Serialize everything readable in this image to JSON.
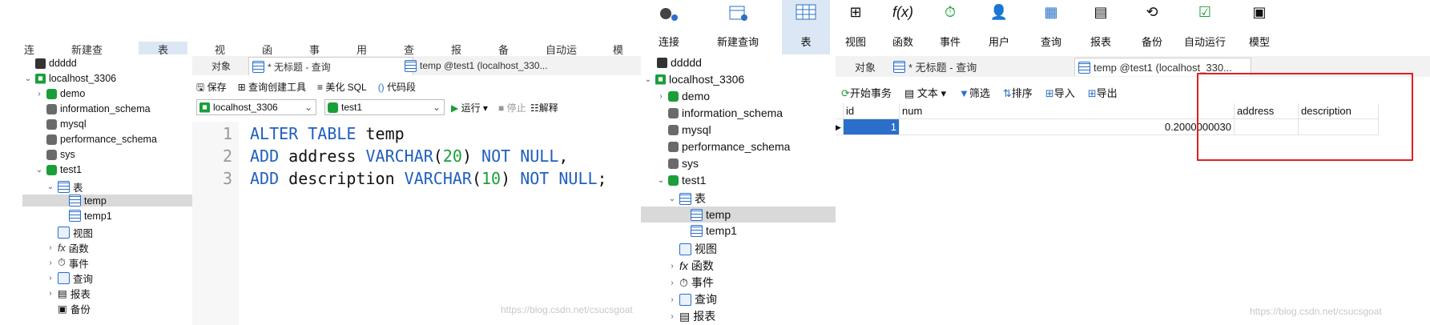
{
  "left": {
    "toolbar": [
      "连接",
      "新建查询",
      "表",
      "视图",
      "函数",
      "事件",
      "用户",
      "查询",
      "报表",
      "备份",
      "自动运行",
      "模型"
    ],
    "tree": {
      "items": [
        {
          "label": "ddddd",
          "icon": "connection-icon"
        },
        {
          "label": "localhost_3306",
          "icon": "connection-icon"
        },
        {
          "label": "demo",
          "icon": "database-icon"
        },
        {
          "label": "information_schema",
          "icon": "database-icon"
        },
        {
          "label": "mysql",
          "icon": "database-icon"
        },
        {
          "label": "performance_schema",
          "icon": "database-icon"
        },
        {
          "label": "sys",
          "icon": "database-icon"
        },
        {
          "label": "test1",
          "icon": "database-icon"
        },
        {
          "label": "表",
          "icon": "table-icon"
        },
        {
          "label": "temp",
          "icon": "table-icon"
        },
        {
          "label": "temp1",
          "icon": "table-icon"
        },
        {
          "label": "视图",
          "icon": "view-icon"
        },
        {
          "label": "函数",
          "icon": "function-icon"
        },
        {
          "label": "事件",
          "icon": "event-icon"
        },
        {
          "label": "查询",
          "icon": "query-icon"
        },
        {
          "label": "报表",
          "icon": "report-icon"
        },
        {
          "label": "备份",
          "icon": "backup-icon"
        }
      ]
    },
    "tabs": {
      "objects": "对象",
      "query": "* 无标题 - 查询",
      "table": "temp @test1 (localhost_330..."
    },
    "actions": {
      "save": "保存",
      "builder": "查询创建工具",
      "beautify": "美化 SQL",
      "snippet": "代码段"
    },
    "connection_select": "localhost_3306",
    "database_select": "test1",
    "run": "运行",
    "stop": "停止",
    "explain": "解释",
    "code": {
      "line_numbers": [
        "1",
        "2",
        "3"
      ],
      "l1_kw": "ALTER TABLE",
      "l1_rest": " temp",
      "l2_kw": "ADD",
      "l2_name": " address ",
      "l2_type": "VARCHAR",
      "l2_p1": "(",
      "l2_num": "20",
      "l2_p2": ") ",
      "l2_null": "NOT NULL",
      "l2_end": ",",
      "l3_kw": "ADD",
      "l3_name": " description ",
      "l3_type": "VARCHAR",
      "l3_p1": "(",
      "l3_num": "10",
      "l3_p2": ") ",
      "l3_null": "NOT NULL",
      "l3_end": ";"
    },
    "watermark": "https://blog.csdn.net/csucsgoat"
  },
  "right": {
    "toolbar": [
      "连接",
      "新建查询",
      "表",
      "视图",
      "函数",
      "事件",
      "用户",
      "查询",
      "报表",
      "备份",
      "自动运行",
      "模型"
    ],
    "tree": {
      "items": [
        {
          "label": "ddddd"
        },
        {
          "label": "localhost_3306"
        },
        {
          "label": "demo"
        },
        {
          "label": "information_schema"
        },
        {
          "label": "mysql"
        },
        {
          "label": "performance_schema"
        },
        {
          "label": "sys"
        },
        {
          "label": "test1"
        },
        {
          "label": "表"
        },
        {
          "label": "temp"
        },
        {
          "label": "temp1"
        },
        {
          "label": "视图"
        },
        {
          "label": "函数"
        },
        {
          "label": "事件"
        },
        {
          "label": "查询"
        },
        {
          "label": "报表"
        }
      ]
    },
    "tabs": {
      "objects": "对象",
      "query": "* 无标题 - 查询",
      "table": "temp @test1 (localhost_330..."
    },
    "actions": {
      "begin": "开始事务",
      "text": "文本",
      "filter": "筛选",
      "sort": "排序",
      "import": "导入",
      "export": "导出"
    },
    "grid": {
      "columns": [
        "id",
        "num",
        "address",
        "description"
      ],
      "rows": [
        [
          "1",
          "0.2000000030",
          "",
          ""
        ]
      ]
    },
    "watermark": "https://blog.csdn.net/csucsgoat",
    "highlight_color": "#e02020"
  }
}
